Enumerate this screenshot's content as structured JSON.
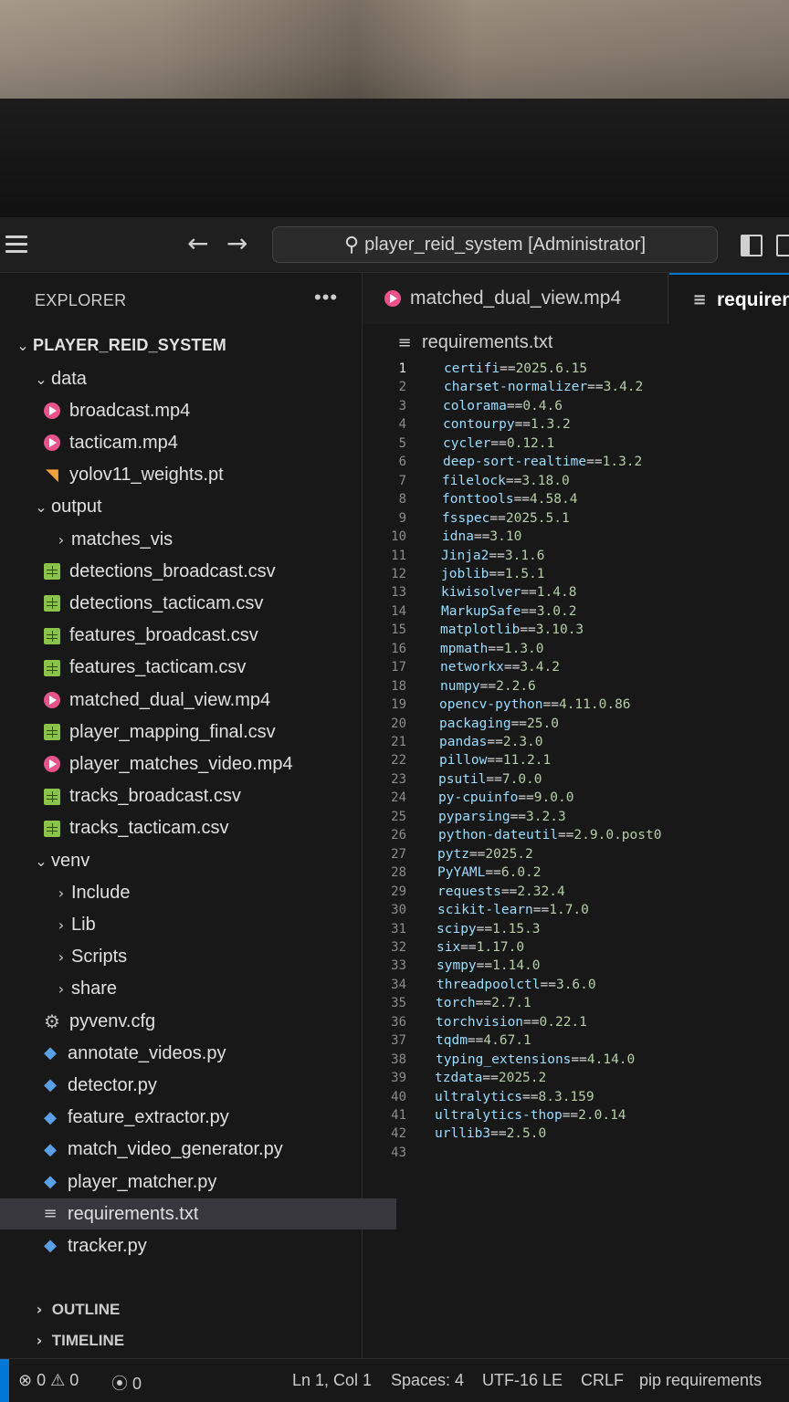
{
  "window": {
    "search_text": "player_reid_system [Administrator]"
  },
  "sidebar": {
    "header": "EXPLORER",
    "more": "•••",
    "root": "PLAYER_REID_SYSTEM",
    "tree": [
      {
        "label": "data",
        "type": "folder-open"
      },
      {
        "label": "broadcast.mp4",
        "type": "video"
      },
      {
        "label": "tacticam.mp4",
        "type": "video"
      },
      {
        "label": "yolov11_weights.pt",
        "type": "rss"
      },
      {
        "label": "output",
        "type": "folder-open"
      },
      {
        "label": "matches_vis",
        "type": "folder-closed"
      },
      {
        "label": "detections_broadcast.csv",
        "type": "csv"
      },
      {
        "label": "detections_tacticam.csv",
        "type": "csv"
      },
      {
        "label": "features_broadcast.csv",
        "type": "csv"
      },
      {
        "label": "features_tacticam.csv",
        "type": "csv"
      },
      {
        "label": "matched_dual_view.mp4",
        "type": "video"
      },
      {
        "label": "player_mapping_final.csv",
        "type": "csv"
      },
      {
        "label": "player_matches_video.mp4",
        "type": "video"
      },
      {
        "label": "tracks_broadcast.csv",
        "type": "csv"
      },
      {
        "label": "tracks_tacticam.csv",
        "type": "csv"
      },
      {
        "label": "venv",
        "type": "folder-open"
      },
      {
        "label": "Include",
        "type": "folder-closed"
      },
      {
        "label": "Lib",
        "type": "folder-closed"
      },
      {
        "label": "Scripts",
        "type": "folder-closed"
      },
      {
        "label": "share",
        "type": "folder-closed"
      },
      {
        "label": "pyvenv.cfg",
        "type": "gear"
      },
      {
        "label": "annotate_videos.py",
        "type": "python"
      },
      {
        "label": "detector.py",
        "type": "python"
      },
      {
        "label": "feature_extractor.py",
        "type": "python"
      },
      {
        "label": "match_video_generator.py",
        "type": "python"
      },
      {
        "label": "player_matcher.py",
        "type": "python"
      },
      {
        "label": "requirements.txt",
        "type": "text",
        "selected": true
      },
      {
        "label": "tracker.py",
        "type": "python"
      }
    ],
    "outline": "OUTLINE",
    "timeline": "TIMELINE"
  },
  "editor": {
    "tabs": [
      {
        "label": "matched_dual_view.mp4",
        "icon": "video-icon"
      },
      {
        "label": "requiren",
        "icon": "text-file-icon",
        "active": true
      }
    ],
    "breadcrumb": "requirements.txt",
    "lines": [
      {
        "n": "1",
        "pkg": "certifi",
        "op": "==",
        "ver": "2025.6.15"
      },
      {
        "n": "2",
        "pkg": "charset-normalizer",
        "op": "==",
        "ver": "3.4.2"
      },
      {
        "n": "3",
        "pkg": "colorama",
        "op": "==",
        "ver": "0.4.6"
      },
      {
        "n": "4",
        "pkg": "contourpy",
        "op": "==",
        "ver": "1.3.2"
      },
      {
        "n": "5",
        "pkg": "cycler",
        "op": "==",
        "ver": "0.12.1"
      },
      {
        "n": "6",
        "pkg": "deep-sort-realtime",
        "op": "==",
        "ver": "1.3.2"
      },
      {
        "n": "7",
        "pkg": "filelock",
        "op": "==",
        "ver": "3.18.0"
      },
      {
        "n": "8",
        "pkg": "fonttools",
        "op": "==",
        "ver": "4.58.4"
      },
      {
        "n": "9",
        "pkg": "fsspec",
        "op": "==",
        "ver": "2025.5.1"
      },
      {
        "n": "10",
        "pkg": "idna",
        "op": "==",
        "ver": "3.10"
      },
      {
        "n": "11",
        "pkg": "Jinja2",
        "op": "==",
        "ver": "3.1.6"
      },
      {
        "n": "12",
        "pkg": "joblib",
        "op": "==",
        "ver": "1.5.1"
      },
      {
        "n": "13",
        "pkg": "kiwisolver",
        "op": "==",
        "ver": "1.4.8"
      },
      {
        "n": "14",
        "pkg": "MarkupSafe",
        "op": "==",
        "ver": "3.0.2"
      },
      {
        "n": "15",
        "pkg": "matplotlib",
        "op": "==",
        "ver": "3.10.3"
      },
      {
        "n": "16",
        "pkg": "mpmath",
        "op": "==",
        "ver": "1.3.0"
      },
      {
        "n": "17",
        "pkg": "networkx",
        "op": "==",
        "ver": "3.4.2"
      },
      {
        "n": "18",
        "pkg": "numpy",
        "op": "==",
        "ver": "2.2.6"
      },
      {
        "n": "19",
        "pkg": "opencv-python",
        "op": "==",
        "ver": "4.11.0.86"
      },
      {
        "n": "20",
        "pkg": "packaging",
        "op": "==",
        "ver": "25.0"
      },
      {
        "n": "21",
        "pkg": "pandas",
        "op": "==",
        "ver": "2.3.0"
      },
      {
        "n": "22",
        "pkg": "pillow",
        "op": "==",
        "ver": "11.2.1"
      },
      {
        "n": "23",
        "pkg": "psutil",
        "op": "==",
        "ver": "7.0.0"
      },
      {
        "n": "24",
        "pkg": "py-cpuinfo",
        "op": "==",
        "ver": "9.0.0"
      },
      {
        "n": "25",
        "pkg": "pyparsing",
        "op": "==",
        "ver": "3.2.3"
      },
      {
        "n": "26",
        "pkg": "python-dateutil",
        "op": "==",
        "ver": "2.9.0.post0"
      },
      {
        "n": "27",
        "pkg": "pytz",
        "op": "==",
        "ver": "2025.2"
      },
      {
        "n": "28",
        "pkg": "PyYAML",
        "op": "==",
        "ver": "6.0.2"
      },
      {
        "n": "29",
        "pkg": "requests",
        "op": "==",
        "ver": "2.32.4"
      },
      {
        "n": "30",
        "pkg": "scikit-learn",
        "op": "==",
        "ver": "1.7.0"
      },
      {
        "n": "31",
        "pkg": "scipy",
        "op": "==",
        "ver": "1.15.3"
      },
      {
        "n": "32",
        "pkg": "six",
        "op": "==",
        "ver": "1.17.0"
      },
      {
        "n": "33",
        "pkg": "sympy",
        "op": "==",
        "ver": "1.14.0"
      },
      {
        "n": "34",
        "pkg": "threadpoolctl",
        "op": "==",
        "ver": "3.6.0"
      },
      {
        "n": "35",
        "pkg": "torch",
        "op": "==",
        "ver": "2.7.1"
      },
      {
        "n": "36",
        "pkg": "torchvision",
        "op": "==",
        "ver": "0.22.1"
      },
      {
        "n": "37",
        "pkg": "tqdm",
        "op": "==",
        "ver": "4.67.1"
      },
      {
        "n": "38",
        "pkg": "typing_extensions",
        "op": "==",
        "ver": "4.14.0"
      },
      {
        "n": "39",
        "pkg": "tzdata",
        "op": "==",
        "ver": "2025.2"
      },
      {
        "n": "40",
        "pkg": "ultralytics",
        "op": "==",
        "ver": "8.3.159"
      },
      {
        "n": "41",
        "pkg": "ultralytics-thop",
        "op": "==",
        "ver": "2.0.14"
      },
      {
        "n": "42",
        "pkg": "urllib3",
        "op": "==",
        "ver": "2.5.0"
      },
      {
        "n": "43",
        "pkg": "",
        "op": "",
        "ver": ""
      }
    ]
  },
  "statusbar": {
    "errors": "0",
    "warnings": "0",
    "ports": "0",
    "position": "Ln 1, Col 1",
    "spaces": "Spaces: 4",
    "encoding": "UTF-16 LE",
    "eol": "CRLF",
    "language": "pip requirements"
  },
  "colors": {
    "accent": "#0078d4",
    "package": "#9cdcfe",
    "version": "#b5cea8",
    "video_icon": "#e8538a",
    "csv_icon": "#8bc34a",
    "python_icon": "#5aa0e6"
  }
}
